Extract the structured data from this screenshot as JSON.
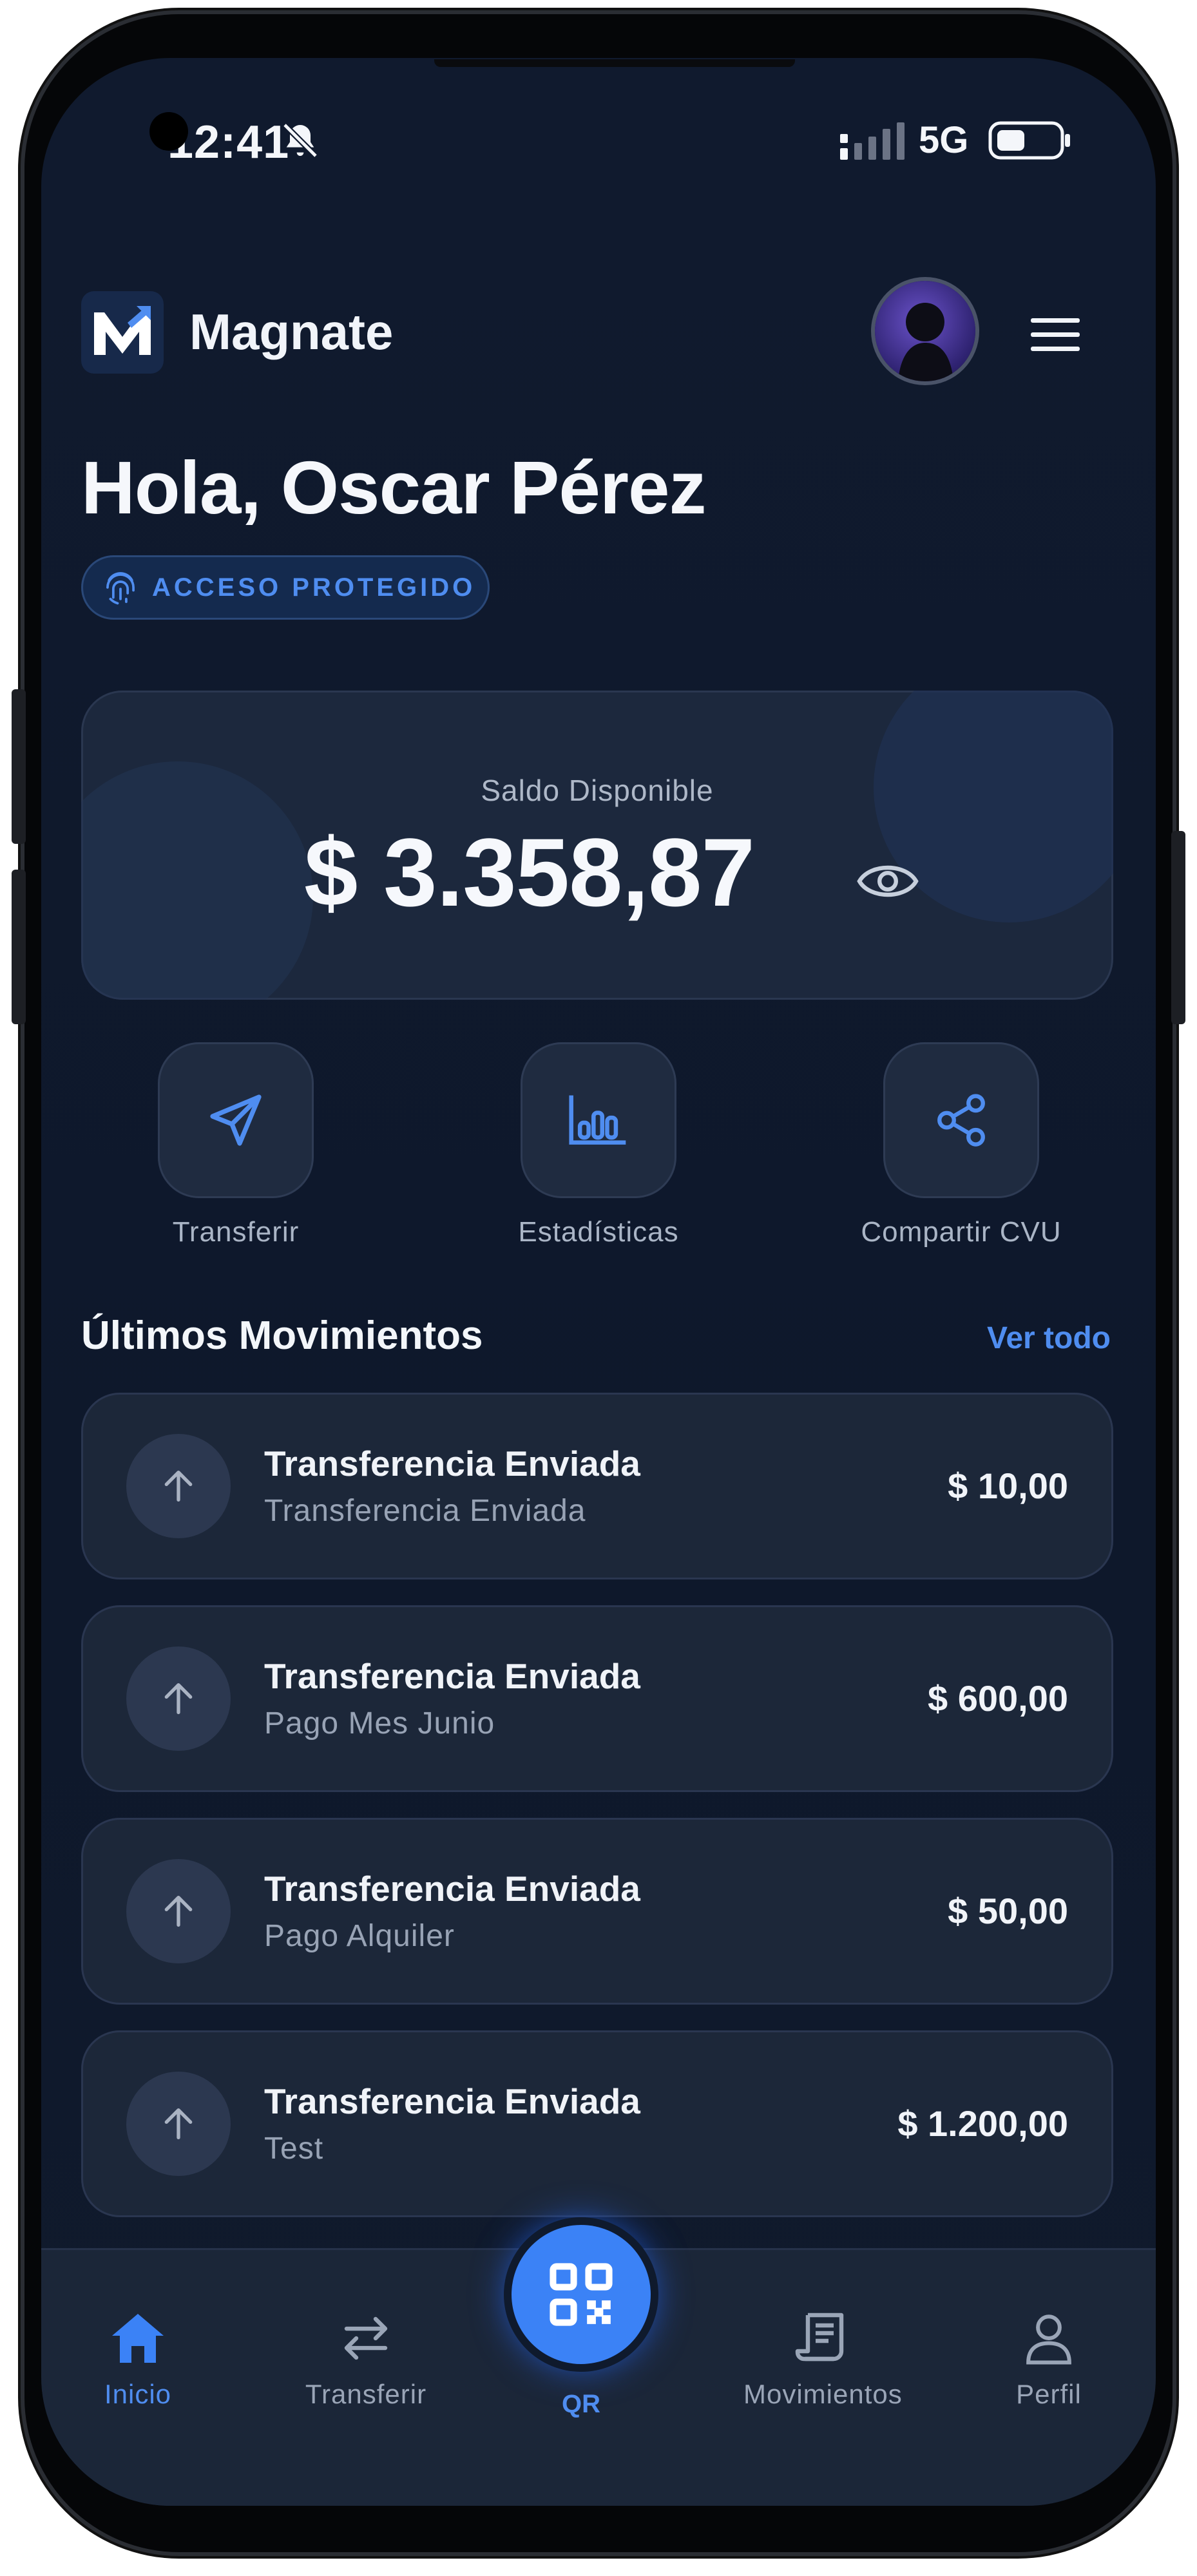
{
  "status_bar": {
    "time": "12:41",
    "network": "5G"
  },
  "header": {
    "app_name": "Magnate"
  },
  "greeting": "Hola, Oscar Pérez",
  "security_badge": "ACCESO PROTEGIDO",
  "balance": {
    "label": "Saldo Disponible",
    "amount": "$ 3.358,87"
  },
  "quick_actions": [
    {
      "label": "Transferir",
      "icon": "send-icon"
    },
    {
      "label": "Estadísticas",
      "icon": "bar-chart-icon"
    },
    {
      "label": "Compartir CVU",
      "icon": "share-icon"
    }
  ],
  "movements": {
    "title": "Últimos Movimientos",
    "see_all": "Ver todo",
    "items": [
      {
        "title": "Transferencia Enviada",
        "subtitle": "Transferencia Enviada",
        "amount": "$ 10,00"
      },
      {
        "title": "Transferencia Enviada",
        "subtitle": "Pago Mes Junio",
        "amount": "$ 600,00"
      },
      {
        "title": "Transferencia Enviada",
        "subtitle": "Pago Alquiler",
        "amount": "$ 50,00"
      },
      {
        "title": "Transferencia Enviada",
        "subtitle": "Test",
        "amount": "$ 1.200,00"
      }
    ]
  },
  "bottom_nav": {
    "items": [
      {
        "label": "Inicio",
        "icon": "home-icon",
        "active": true
      },
      {
        "label": "Transferir",
        "icon": "swap-icon",
        "active": false
      },
      {
        "label": "QR",
        "icon": "qr-icon",
        "active": false
      },
      {
        "label": "Movimientos",
        "icon": "receipt-icon",
        "active": false
      },
      {
        "label": "Perfil",
        "icon": "user-icon",
        "active": false
      }
    ]
  },
  "colors": {
    "accent": "#3b82f6",
    "background": "#101a2e",
    "card": "#1c283d"
  }
}
